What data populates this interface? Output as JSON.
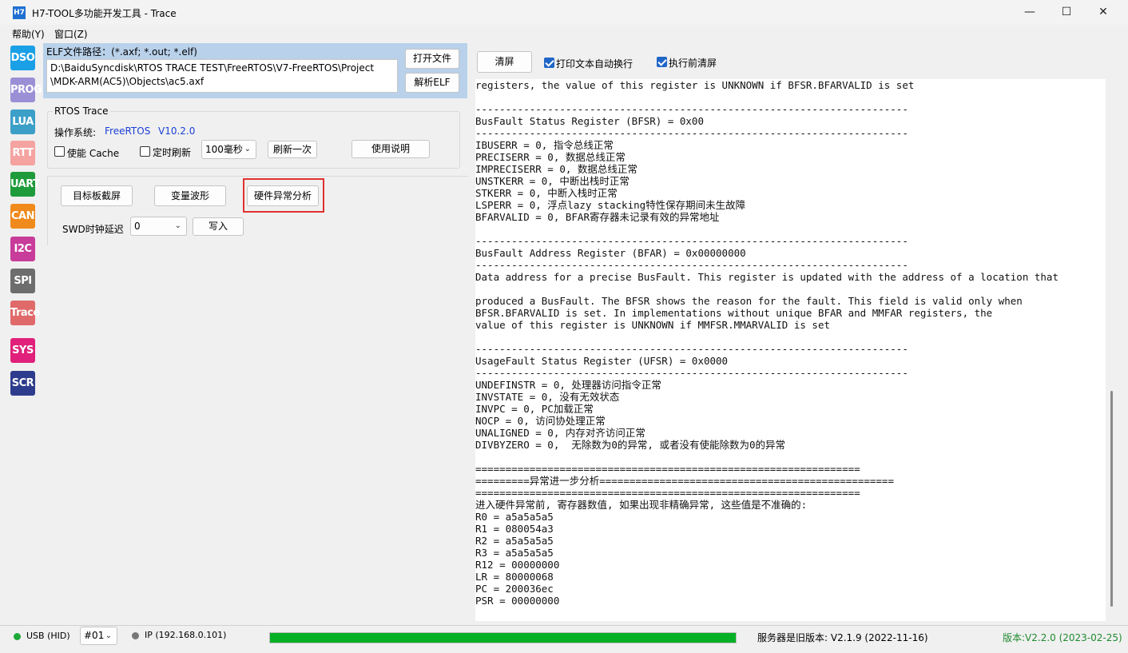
{
  "window": {
    "app_icon_text": "H7",
    "title": "H7-TOOL多功能开发工具 - Trace",
    "minimize": "—",
    "maximize": "☐",
    "close": "✕"
  },
  "menu": [
    "帮助(Y)",
    "窗口(Z)"
  ],
  "toolbar": [
    {
      "label": "DSO",
      "color": "#1aa0e6"
    },
    {
      "label": "PROG",
      "color": "#9b8fd6"
    },
    {
      "label": "LUA",
      "color": "#3c9fc8"
    },
    {
      "label": "RTT",
      "color": "#f5a3a0"
    },
    {
      "label": "UART",
      "color": "#1f9b3b"
    },
    {
      "label": "CAN",
      "color": "#f08a1c"
    },
    {
      "label": "I2C",
      "color": "#c83c9a"
    },
    {
      "label": "SPI",
      "color": "#6d6d6d"
    },
    {
      "label": "Trace",
      "color": "#e06a6a"
    },
    {
      "label": "SYS",
      "color": "#e0207a"
    },
    {
      "label": "SCR",
      "color": "#2d3c8c"
    }
  ],
  "elf": {
    "label": "ELF文件路径：(*.axf; *.out; *.elf)",
    "path_line1": "D:\\BaiduSyncdisk\\RTOS TRACE TEST\\FreeRTOS\\V7-FreeRTOS\\Project",
    "path_line2": "\\MDK-ARM(AC5)\\Objects\\ac5.axf",
    "open_button": "打开文件",
    "parse_button": "解析ELF"
  },
  "rtos": {
    "group_title": "RTOS Trace",
    "os_label": "操作系统:",
    "os_name": "FreeRTOS",
    "os_version": "V10.2.0",
    "cache_label": "使能 Cache",
    "timer_label": "定时刷新",
    "interval_value": "100毫秒",
    "refresh_button": "刷新一次",
    "help_button": "使用说明"
  },
  "actions": {
    "screenshot_button": "目标板截屏",
    "waveform_button": "变量波形",
    "fault_button": "硬件异常分析",
    "swd_label": "SWD时钟延迟",
    "swd_value": "0",
    "write_button": "写入"
  },
  "output_panel": {
    "clear_button": "清屏",
    "autowrap_label": "打印文本自动换行",
    "clear_before_label": "执行前清屏",
    "text": "registers, the value of this register is UNKNOWN if BFSR.BFARVALID is set\n\n------------------------------------------------------------------------\nBusFault Status Register (BFSR) = 0x00\n------------------------------------------------------------------------\nIBUSERR = 0, 指令总线正常\nPRECISERR = 0, 数据总线正常\nIMPRECISERR = 0, 数据总线正常\nUNSTKERR = 0, 中断出栈时正常\nSTKERR = 0, 中断入栈时正常\nLSPERR = 0, 浮点lazy stacking特性保存期间未生故障\nBFARVALID = 0, BFAR寄存器未记录有效的异常地址\n\n------------------------------------------------------------------------\nBusFault Address Register (BFAR) = 0x00000000\n------------------------------------------------------------------------\nData address for a precise BusFault. This register is updated with the address of a location that\n\nproduced a BusFault. The BFSR shows the reason for the fault. This field is valid only when\nBFSR.BFARVALID is set. In implementations without unique BFAR and MMFAR registers, the\nvalue of this register is UNKNOWN if MMFSR.MMARVALID is set\n\n------------------------------------------------------------------------\nUsageFault Status Register (UFSR) = 0x0000\n------------------------------------------------------------------------\nUNDEFINSTR = 0, 处理器访问指令正常\nINVSTATE = 0, 没有无效状态\nINVPC = 0, PC加载正常\nNOCP = 0, 访问协处理正常\nUNALIGNED = 0, 内存对齐访问正常\nDIVBYZERO = 0,  无除数为0的异常, 或者没有使能除数为0的异常\n\n================================================================\n=========异常进一步分析=================================================\n================================================================\n进入硬件异常前, 寄存器数值, 如果出现非精确异常, 这些值是不准确的:\nR0 = a5a5a5a5\nR1 = 080054a3\nR2 = a5a5a5a5\nR3 = a5a5a5a5\nR12 = 00000000\nLR = 80000068\nPC = 200036ec\nPSR = 00000000"
  },
  "status": {
    "usb": "USB (HID)",
    "device": "#01",
    "ip": "IP (192.168.0.101)",
    "progress": 1.0,
    "server": "服务器是旧版本: V2.1.9 (2022-11-16)",
    "version": "版本:V2.2.0 (2023-02-25)",
    "usb_color": "#1fa83a",
    "ip_color": "#777777",
    "version_color": "#1f8a2e"
  }
}
